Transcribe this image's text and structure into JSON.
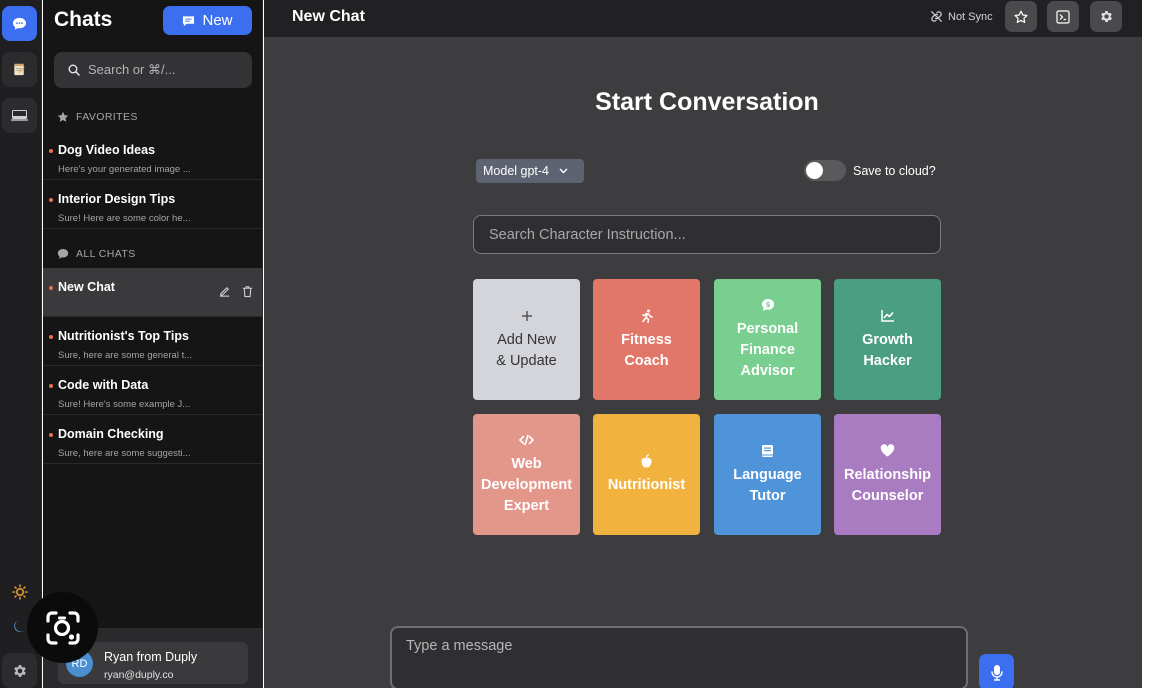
{
  "rail": {
    "items": [
      {
        "name": "chats",
        "icon": "chat-bubble-icon"
      },
      {
        "name": "notes",
        "icon": "notepad-icon"
      },
      {
        "name": "terminal",
        "icon": "terminal-icon"
      }
    ],
    "bottom": [
      "sun-icon",
      "moon-icon",
      "gear-icon"
    ]
  },
  "sidebar": {
    "title": "Chats",
    "new_button": "New",
    "search_placeholder": "Search or ⌘/...",
    "favorites_label": "FAVORITES",
    "all_chats_label": "ALL CHATS",
    "favorites": [
      {
        "title": "Dog Video Ideas",
        "snippet": "Here's your generated image ..."
      },
      {
        "title": "Interior Design Tips",
        "snippet": "Sure! Here are some color he..."
      }
    ],
    "chats": [
      {
        "title": "New Chat",
        "snippet": "",
        "active": true
      },
      {
        "title": "Nutritionist's Top Tips",
        "snippet": "Sure, here are some general t..."
      },
      {
        "title": "Code with Data",
        "snippet": "Sure! Here's some example J..."
      },
      {
        "title": "Domain Checking",
        "snippet": "Sure, here are some suggesti..."
      }
    ],
    "user": {
      "initials": "RD",
      "name": "Ryan from Duply",
      "email": "ryan@duply.co"
    }
  },
  "header": {
    "title": "New Chat",
    "sync_status": "Not Sync",
    "buttons": [
      "star-icon",
      "terminal-icon",
      "gear-icon"
    ]
  },
  "main": {
    "heading": "Start Conversation",
    "model_select": "Model gpt-4",
    "save_cloud_label": "Save to cloud?",
    "save_cloud_on": false,
    "search_placeholder": "Search Character Instruction...",
    "cards": [
      {
        "label": "Add New & Update",
        "lines": [
          "Add New",
          "& Update"
        ],
        "icon": "plus-icon",
        "color": "#d3d5da"
      },
      {
        "label": "Fitness Coach",
        "lines": [
          "Fitness",
          "Coach"
        ],
        "icon": "running-icon",
        "color": "#e17769"
      },
      {
        "label": "Personal Finance Advisor",
        "lines": [
          "Personal",
          "Finance",
          "Advisor"
        ],
        "icon": "money-bubble-icon",
        "color": "#78cf8f"
      },
      {
        "label": "Growth Hacker",
        "lines": [
          "Growth",
          "Hacker"
        ],
        "icon": "chart-line-icon",
        "color": "#4a9f83"
      },
      {
        "label": "Web Development Expert",
        "lines": [
          "Web",
          "Development",
          "Expert"
        ],
        "icon": "code-icon",
        "color": "#e3968a"
      },
      {
        "label": "Nutritionist",
        "lines": [
          "Nutritionist"
        ],
        "icon": "apple-icon",
        "color": "#f1b23e"
      },
      {
        "label": "Language Tutor",
        "lines": [
          "Language",
          "Tutor"
        ],
        "icon": "book-icon",
        "color": "#4f93d8"
      },
      {
        "label": "Relationship Counselor",
        "lines": [
          "Relationship",
          "Counselor"
        ],
        "icon": "heart-icon",
        "color": "#a97cc2"
      }
    ],
    "message_placeholder": "Type a message"
  }
}
